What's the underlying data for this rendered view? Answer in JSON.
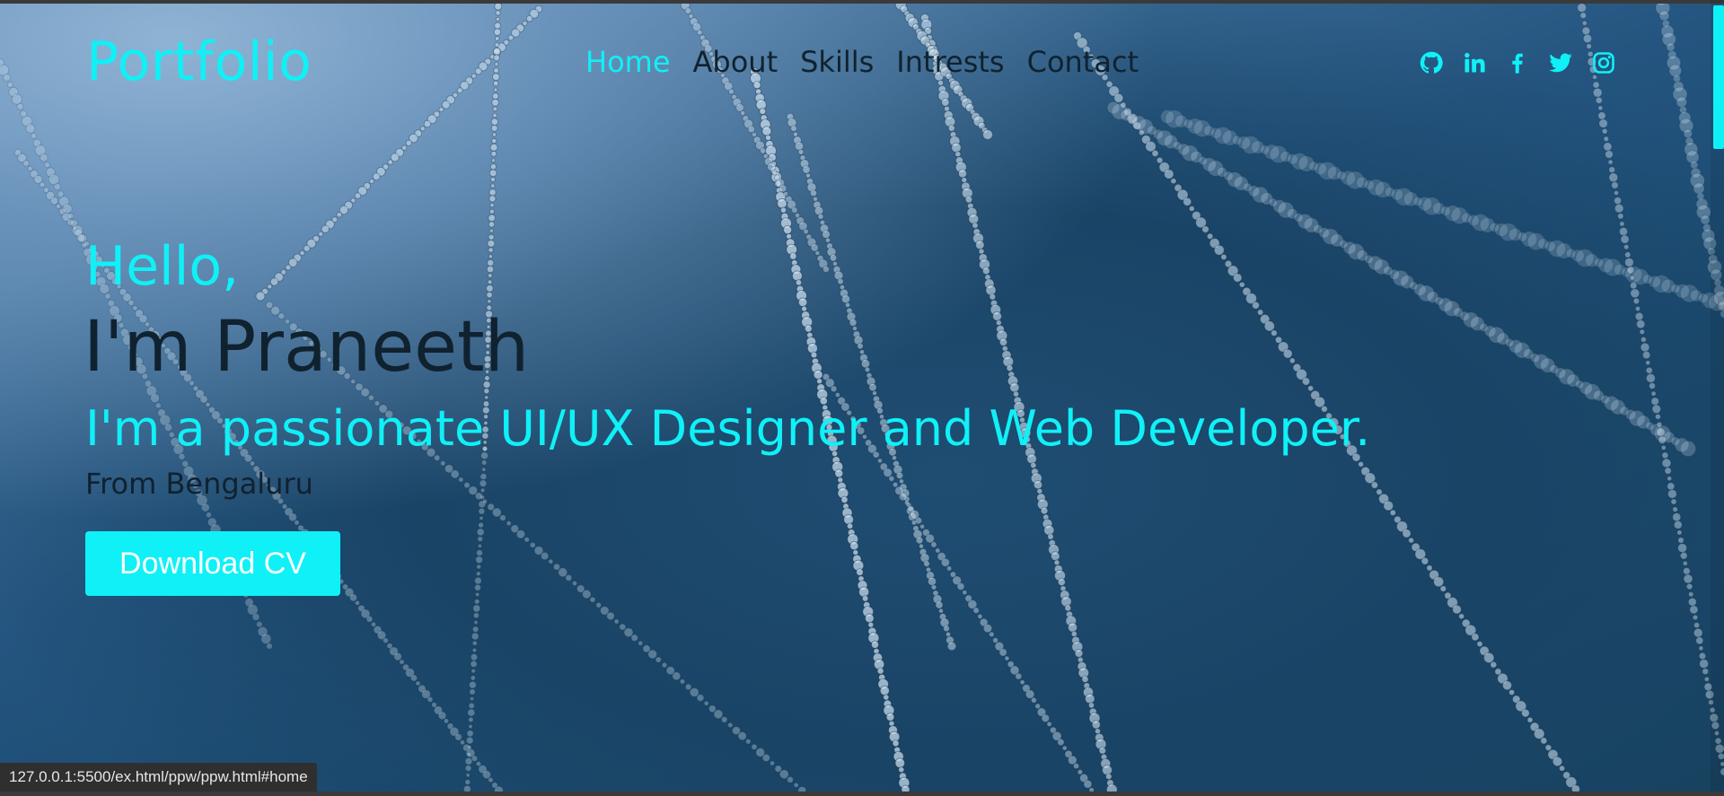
{
  "brand": {
    "logo_text": "Portfolio",
    "accent_color": "#0ff1f7",
    "text_dark": "#10222f"
  },
  "nav": {
    "items": [
      {
        "label": "Home",
        "active": true
      },
      {
        "label": "About",
        "active": false
      },
      {
        "label": "Skills",
        "active": false
      },
      {
        "label": "Intrests",
        "active": false
      },
      {
        "label": "Contact",
        "active": false
      }
    ]
  },
  "social": {
    "icons": [
      "github-icon",
      "linkedin-icon",
      "facebook-icon",
      "twitter-icon",
      "instagram-icon"
    ]
  },
  "hero": {
    "greeting": "Hello,",
    "name": "I'm Praneeth",
    "tagline": "I'm a passionate UI/UX Designer and Web Developer.",
    "location": "From Bengaluru",
    "cta_label": "Download CV"
  },
  "browser": {
    "status_url": "127.0.0.1:5500/ex.html/ppw/ppw.html#home"
  }
}
